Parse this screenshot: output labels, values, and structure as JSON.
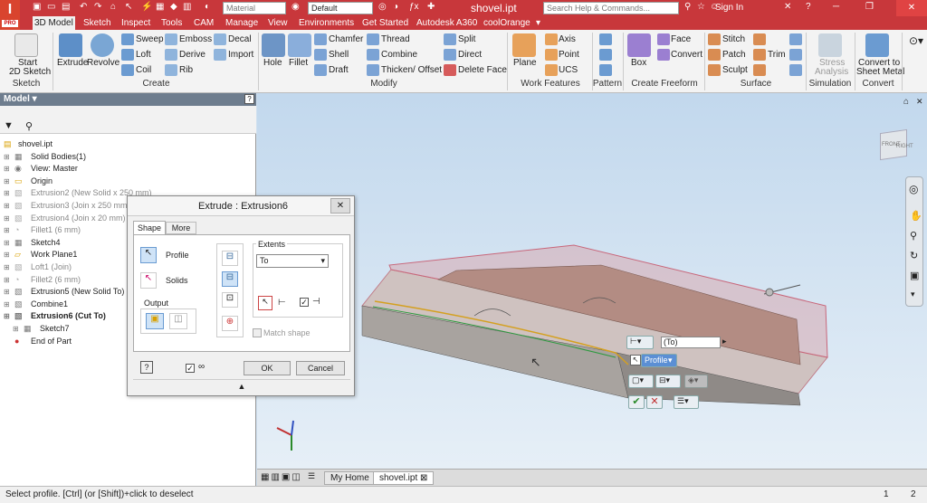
{
  "titlebar": {
    "material_placeholder": "Material",
    "appearance": "Default",
    "search_placeholder": "Search Help & Commands...",
    "doc_title": "shovel.ipt",
    "sign_in": "Sign In",
    "logo_text": "I",
    "logo_sub": "PRO"
  },
  "tabs": [
    "3D Model",
    "Sketch",
    "Inspect",
    "Tools",
    "CAM",
    "Manage",
    "View",
    "Environments",
    "Get Started",
    "Autodesk A360",
    "coolOrange"
  ],
  "ribbon": {
    "sketch": {
      "start": "Start",
      "start2": "2D Sketch",
      "group": "Sketch"
    },
    "create": {
      "extrude": "Extrude",
      "revolve": "Revolve",
      "sweep": "Sweep",
      "loft": "Loft",
      "coil": "Coil",
      "emboss": "Emboss",
      "derive": "Derive",
      "rib": "Rib",
      "decal": "Decal",
      "import": "Import",
      "group": "Create"
    },
    "modify": {
      "hole": "Hole",
      "fillet": "Fillet",
      "chamfer": "Chamfer",
      "shell": "Shell",
      "draft": "Draft",
      "thread": "Thread",
      "combine": "Combine",
      "thicken": "Thicken/ Offset",
      "split": "Split",
      "direct": "Direct",
      "delete_face": "Delete Face",
      "group": "Modify"
    },
    "work": {
      "plane": "Plane",
      "axis": "Axis",
      "point": "Point",
      "ucs": "UCS",
      "group": "Work Features"
    },
    "pattern": {
      "group": "Pattern"
    },
    "freeform": {
      "box": "Box",
      "face": "Face",
      "convert": "Convert",
      "group": "Create Freeform"
    },
    "surface": {
      "stitch": "Stitch",
      "patch": "Patch",
      "sculpt": "Sculpt",
      "trim": "Trim",
      "group": "Surface"
    },
    "simulation": {
      "stress": "Stress",
      "analysis": "Analysis",
      "group": "Simulation"
    },
    "convert": {
      "c1": "Convert to",
      "c2": "Sheet Metal",
      "group": "Convert"
    }
  },
  "browser": {
    "title": "Model",
    "items": [
      {
        "label": "shovel.ipt"
      },
      {
        "label": "Solid Bodies(1)"
      },
      {
        "label": "View: Master"
      },
      {
        "label": "Origin"
      },
      {
        "label": "Extrusion2 (New Solid x 250 mm)"
      },
      {
        "label": "Extrusion3 (Join x 250 mm / "
      },
      {
        "label": "Extrusion4 (Join x 20 mm)"
      },
      {
        "label": "Fillet1 (6 mm)"
      },
      {
        "label": "Sketch4"
      },
      {
        "label": "Work Plane1"
      },
      {
        "label": "Loft1 (Join)"
      },
      {
        "label": "Fillet2 (6 mm)"
      },
      {
        "label": "Extrusion5 (New Solid To)"
      },
      {
        "label": "Combine1"
      },
      {
        "label": "Extrusion6 (Cut To)"
      },
      {
        "label": "Sketch7"
      },
      {
        "label": "End of Part"
      }
    ]
  },
  "dialog": {
    "title": "Extrude : Extrusion6",
    "tab_shape": "Shape",
    "tab_more": "More",
    "profile": "Profile",
    "solids": "Solids",
    "output": "Output",
    "extents": "Extents",
    "extent_value": "To",
    "match_shape": "Match shape",
    "ok": "OK",
    "cancel": "Cancel"
  },
  "minitoolbar": {
    "to_value": "(To)",
    "profile": "Profile"
  },
  "viewcube": {
    "front": "FRONT",
    "right": "RIGHT"
  },
  "doctabs": {
    "home": "My Home",
    "doc": "shovel.ipt"
  },
  "status": {
    "text": "Select profile. [Ctrl] (or [Shift])+click to deselect",
    "n1": "1",
    "n2": "2"
  },
  "colors": {
    "title_red": "#c8373b",
    "accent_blue": "#3d7bbf"
  }
}
